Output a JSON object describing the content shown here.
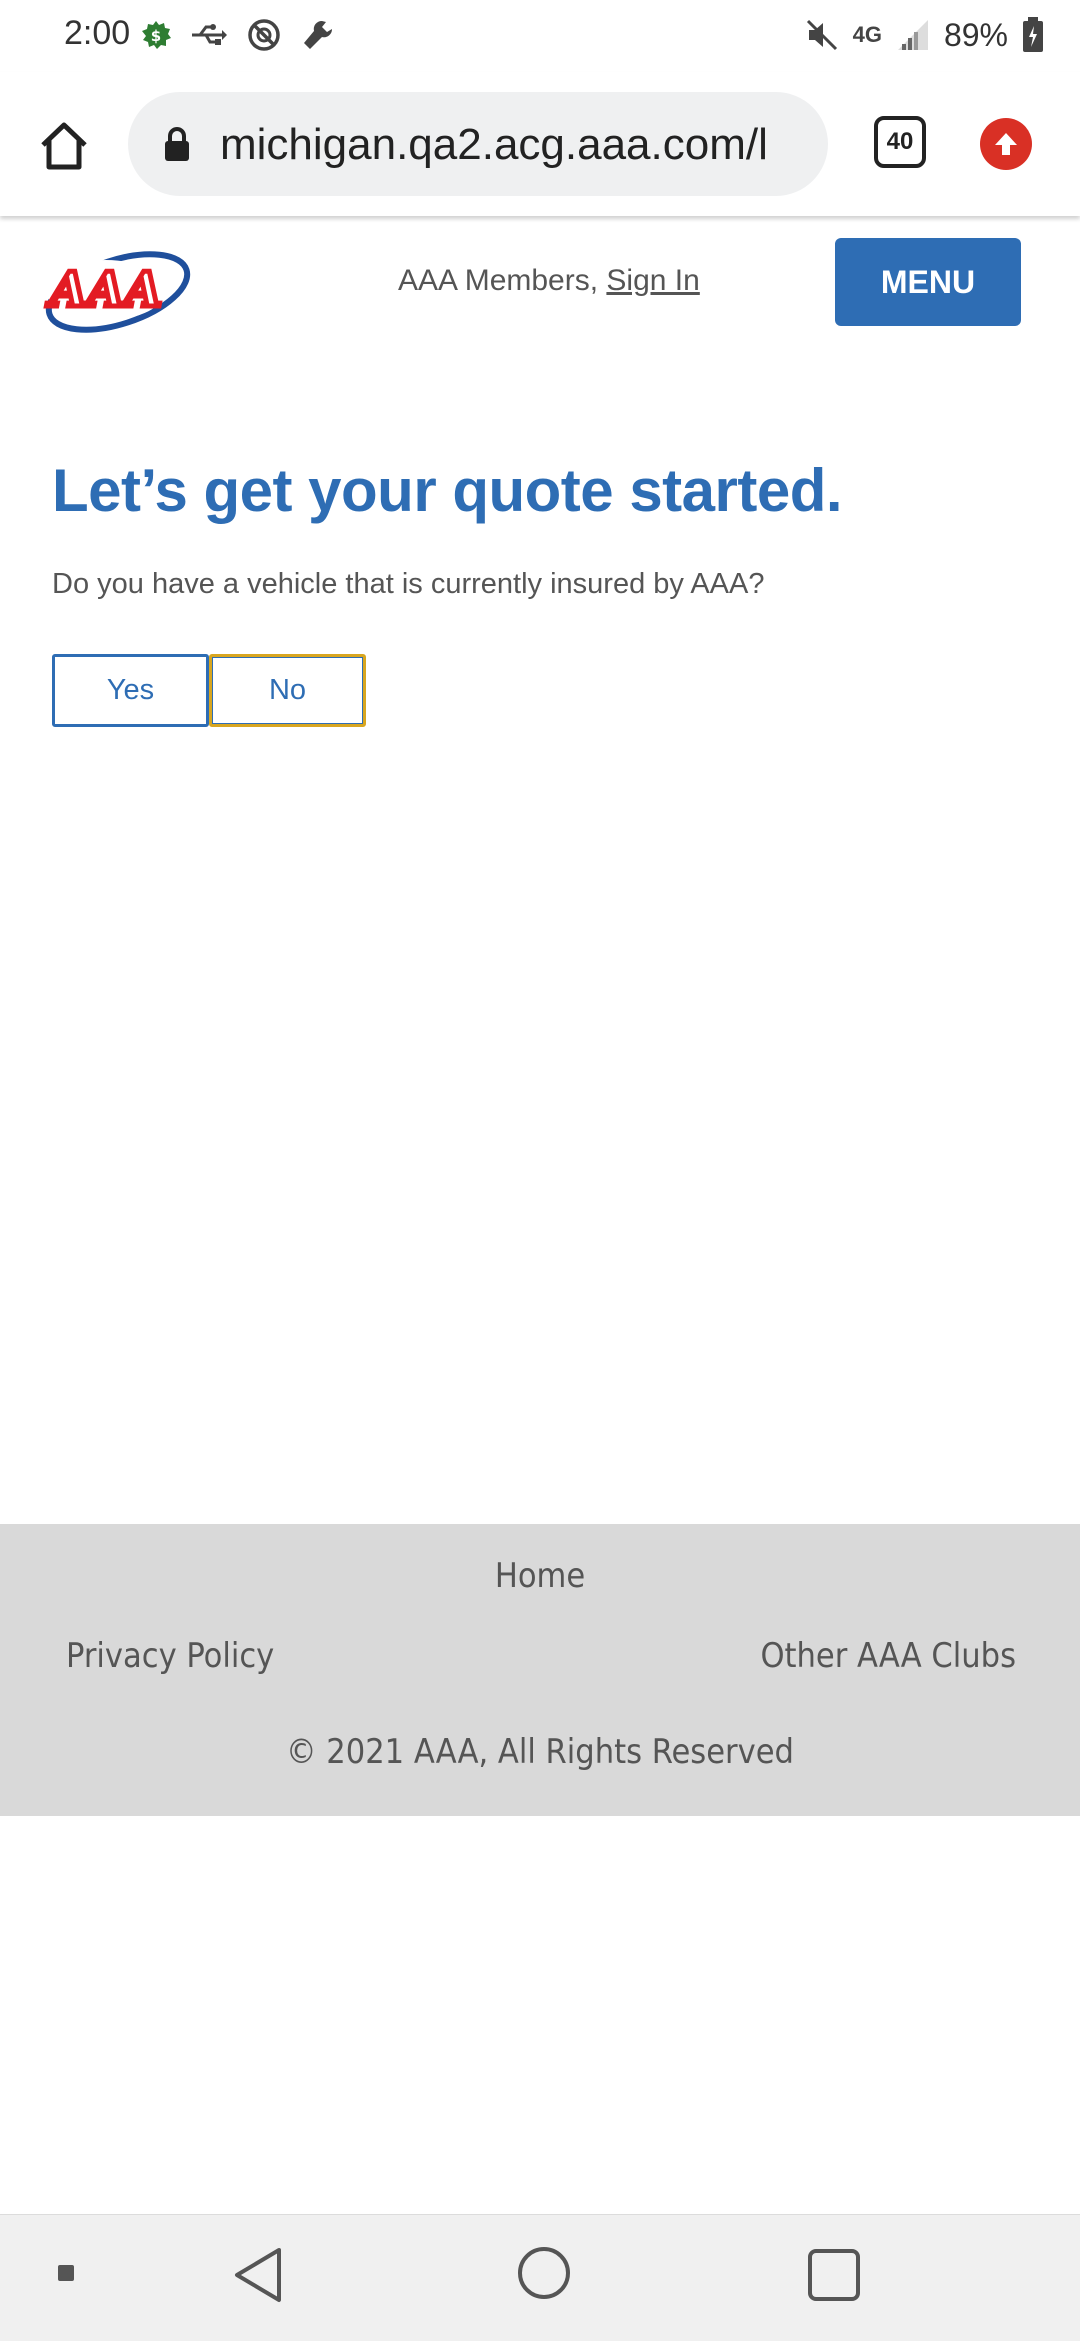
{
  "status_bar": {
    "time": "2:00",
    "network": "4G",
    "battery_pct": "89%",
    "icons": [
      "money-icon",
      "usb-icon",
      "sync-off-icon",
      "wrench-icon",
      "mute-icon",
      "signal-icon",
      "battery-icon"
    ]
  },
  "browser": {
    "url": "michigan.qa2.acg.aaa.com/l",
    "tab_count": "40"
  },
  "header": {
    "logo_text": "AAA",
    "members_text": "AAA Members, ",
    "sign_in_label": "Sign In",
    "menu_label": "MENU"
  },
  "main": {
    "headline": "Let’s get your quote started.",
    "question": "Do you have a vehicle that is currently insured by AAA?",
    "yes_label": "Yes",
    "no_label": "No"
  },
  "footer": {
    "home_label": "Home",
    "privacy_label": "Privacy Policy",
    "other_clubs_label": "Other AAA Clubs",
    "copyright": "© 2021 AAA, All Rights Reserved"
  },
  "colors": {
    "brand_blue": "#2e6db4",
    "focus_outline": "#d8a620",
    "footer_bg": "#d9d9d9",
    "aaa_red": "#e31b23"
  }
}
